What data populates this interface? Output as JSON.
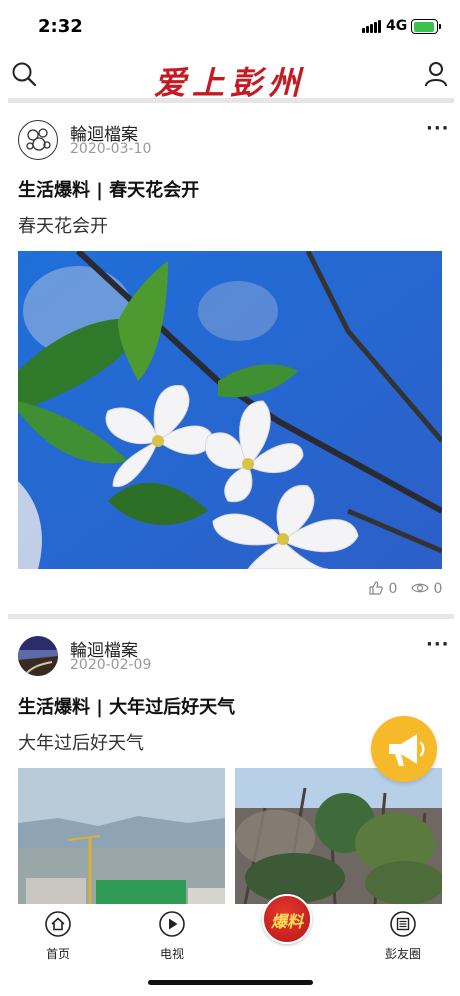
{
  "status_bar": {
    "time": "2:32",
    "network": "4G"
  },
  "header": {
    "logo_text": "爱上彭州",
    "brand_color": "#c51a22"
  },
  "posts": [
    {
      "author": "輪迴檔案",
      "date": "2020-03-10",
      "title": "生活爆料 | 春天花会开",
      "body": "春天花会开",
      "likes": "0",
      "views": "0",
      "more_label": "···"
    },
    {
      "author": "輪迴檔案",
      "date": "2020-02-09",
      "title": "生活爆料 | 大年过后好天气",
      "body": "大年过后好天气",
      "more_label": "···"
    }
  ],
  "fab": {
    "icon": "megaphone-icon",
    "color": "#f5b92a"
  },
  "tabbar": {
    "items": [
      {
        "label": "首页",
        "icon": "home-icon"
      },
      {
        "label": "电视",
        "icon": "play-icon"
      },
      {
        "label": "爆料",
        "icon": "baoliao-badge"
      },
      {
        "label": "彭友圈",
        "icon": "newspaper-icon"
      }
    ]
  }
}
